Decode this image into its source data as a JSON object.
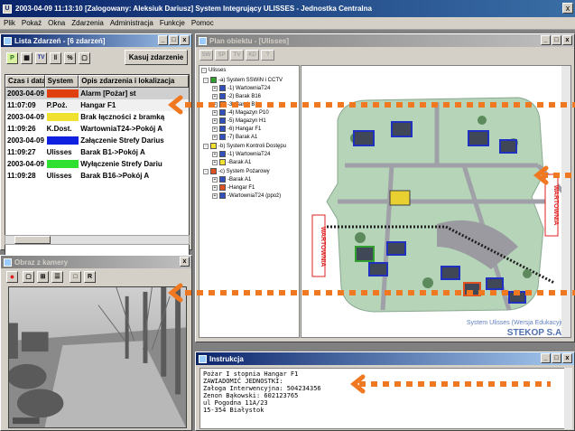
{
  "main_window": {
    "title": "2003-04-09 11:13:10   [Zalogowany: Aleksiuk Dariusz]   System Integrujący ULISSES - Jednostka Centralna",
    "close": "x"
  },
  "menu": [
    "Plik",
    "Pokaż",
    "Okna",
    "Zdarzenia",
    "Administracja",
    "Funkcje",
    "Pomoc"
  ],
  "events_window": {
    "title": "Lista Zdarzeń - [6 zdarzeń]",
    "toolbar_labels": [
      "TV"
    ],
    "clear_button": "Kasuj zdarzenie",
    "columns": [
      "Czas i data",
      "System",
      "Opis zdarzenia i lokalizacja"
    ],
    "rows": [
      {
        "date": "2003-04-09",
        "time": "11:07:09",
        "system": "P.Poż.",
        "color": "#e04010",
        "desc1": "Alarm [Pożar] st",
        "desc2": "Hangar F1"
      },
      {
        "date": "2003-04-09",
        "time": "11:09:26",
        "system": "K.Dost.",
        "color": "#f0e030",
        "desc1": "Brak łączności z bramką",
        "desc2": "WartowniaT24->Pokój A"
      },
      {
        "date": "2003-04-09",
        "time": "11:09:27",
        "system": "Ulisses",
        "color": "#1020e0",
        "desc1": "Załączenie Strefy Darius",
        "desc2": "Barak B1->Pokój A"
      },
      {
        "date": "2003-04-09",
        "time": "11:09:28",
        "system": "Ulisses",
        "color": "#30e030",
        "desc1": "Wyłączenie Strefy Dariu",
        "desc2": "Barak B16->Pokój A"
      }
    ]
  },
  "camera_window": {
    "title": "Obraz z kamery",
    "buttons": [
      "R"
    ]
  },
  "plan_window": {
    "title": "Plan obiektu - [Ulisses]",
    "toolbar": [
      "SW",
      "SP",
      "TV",
      "KD",
      "?"
    ],
    "tree": [
      {
        "label": "Ulisses",
        "color": "#ffffff",
        "level": 0
      },
      {
        "label": "-a) System SSWiN i CCTV",
        "color": "#30a030",
        "level": 1
      },
      {
        "label": "-1) WartowniaT24",
        "color": "#3050c0",
        "level": 2
      },
      {
        "label": "-2) Barak B16",
        "color": "#3050c0",
        "level": 2
      },
      {
        "label": "-3) Barak B1",
        "color": "#30a030",
        "level": 2
      },
      {
        "label": "-4) Magazyn P10",
        "color": "#3050c0",
        "level": 2
      },
      {
        "label": "-5) Magazyn H1",
        "color": "#3050c0",
        "level": 2
      },
      {
        "label": "-6) Hangar F1",
        "color": "#3050c0",
        "level": 2
      },
      {
        "label": "-7) Barak A1",
        "color": "#3050c0",
        "level": 2
      },
      {
        "label": "-b) System Kontroli Dostępu",
        "color": "#f0e030",
        "level": 1
      },
      {
        "label": "-1) WartowniaT24",
        "color": "#3050c0",
        "level": 2
      },
      {
        "label": "-Barak A1",
        "color": "#f0e030",
        "level": 2
      },
      {
        "label": "-c) System Pożarowy",
        "color": "#e05020",
        "level": 1
      },
      {
        "label": "-Barak A1",
        "color": "#3050c0",
        "level": 2
      },
      {
        "label": "-Hangar F1",
        "color": "#e05020",
        "level": 2
      },
      {
        "label": "-WartowniaT24 (ppoż)",
        "color": "#3050c0",
        "level": 2
      }
    ],
    "map_labels": {
      "gate_left": "WARTOWNIA",
      "gate_right": "WARTOWNIA",
      "caption": "System Ulisses (Wersja Edukacyjna)",
      "brand": "STEKOP S.A"
    }
  },
  "instructions_window": {
    "title": "Instrukcja",
    "lines": [
      "Pożar I stopnia Hangar F1",
      "ZAWIADOMIĆ JEDNOSTKI:",
      "Załoga Interwencyjna: 504234356",
      "Zenon Bąkowski: 602123765",
      "ul Pogodna 11A/23",
      "15-354 Białystok"
    ]
  },
  "colors": {
    "annotation": "#f07820",
    "titlebar": "#0a246a"
  }
}
